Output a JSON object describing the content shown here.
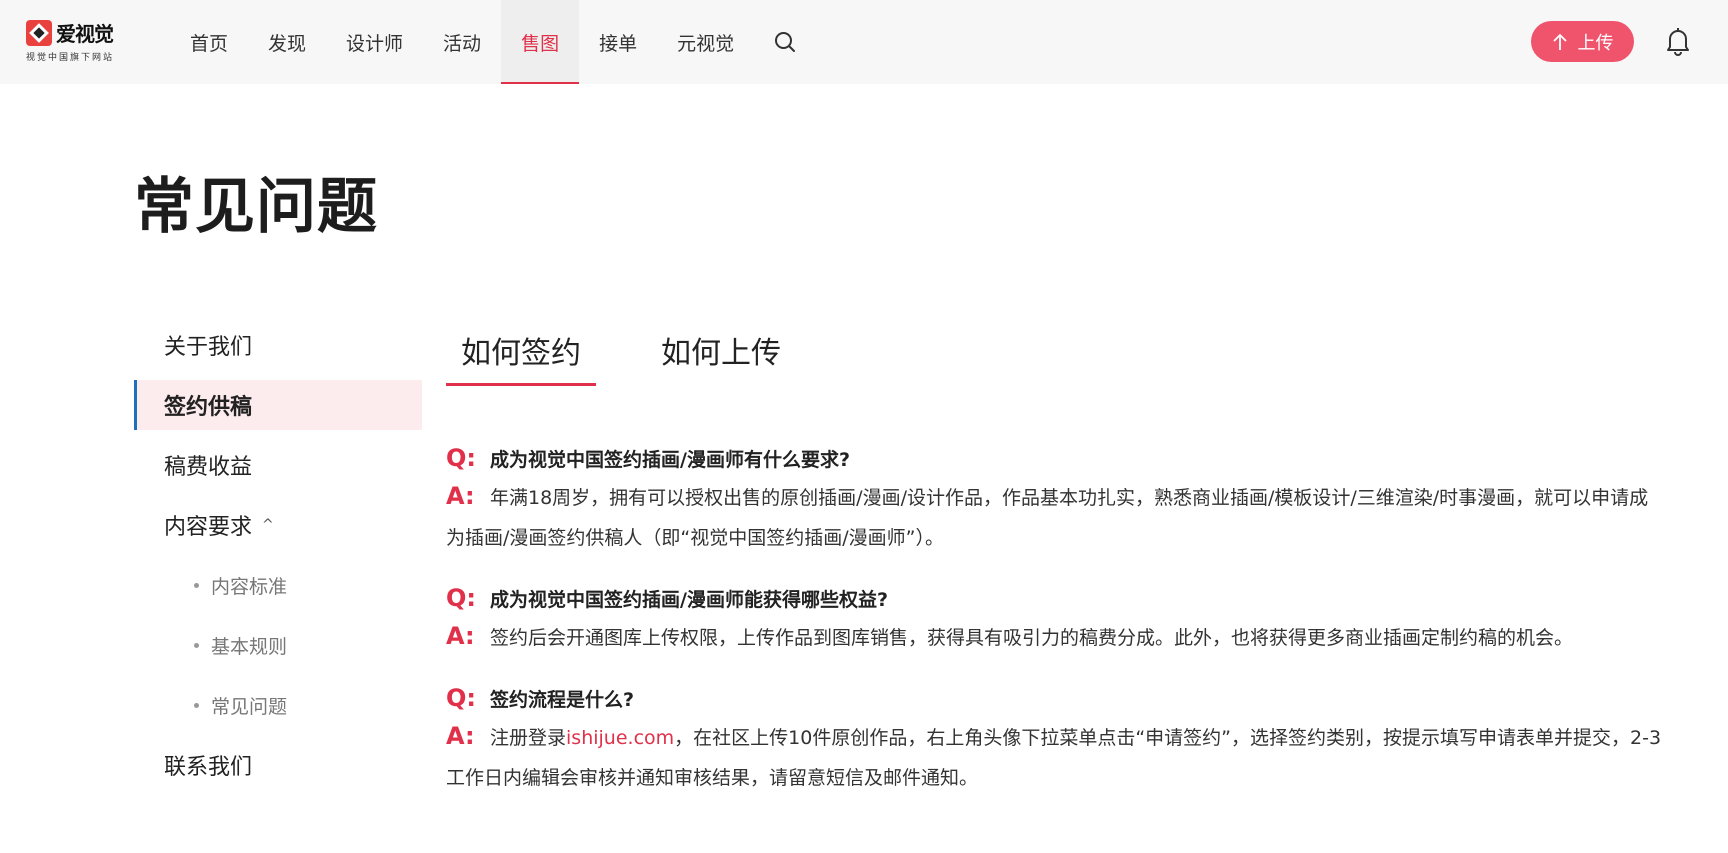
{
  "header": {
    "logo_name": "爱视觉",
    "logo_sub": "视觉中国旗下网站",
    "nav": [
      {
        "label": "首页",
        "active": false
      },
      {
        "label": "发现",
        "active": false
      },
      {
        "label": "设计师",
        "active": false
      },
      {
        "label": "活动",
        "active": false
      },
      {
        "label": "售图",
        "active": true
      },
      {
        "label": "接单",
        "active": false
      },
      {
        "label": "元视觉",
        "active": false
      }
    ],
    "upload_label": "上传",
    "accent_color": "#e0304a",
    "upload_bg": "#f0536c"
  },
  "page": {
    "title": "常见问题"
  },
  "sidebar": {
    "items": [
      {
        "label": "关于我们"
      },
      {
        "label": "签约供稿"
      },
      {
        "label": "稿费收益"
      },
      {
        "label": "内容要求"
      },
      {
        "label": "内容标准"
      },
      {
        "label": "基本规则"
      },
      {
        "label": "常见问题"
      },
      {
        "label": "联系我们"
      }
    ]
  },
  "tabs": [
    {
      "label": "如何签约"
    },
    {
      "label": "如何上传"
    }
  ],
  "faq": {
    "q_mark": "Q:",
    "a_mark": "A:",
    "items": [
      {
        "q": "成为视觉中国签约插画/漫画师有什么要求?",
        "a": "年满18周岁，拥有可以授权出售的原创插画/漫画/设计作品，作品基本功扎实，熟悉商业插画/模板设计/三维渲染/时事漫画，就可以申请成为插画/漫画签约供稿人（即“视觉中国签约插画/漫画师”）。"
      },
      {
        "q": "成为视觉中国签约插画/漫画师能获得哪些权益?",
        "a": "签约后会开通图库上传权限，上传作品到图库销售，获得具有吸引力的稿费分成。此外，也将获得更多商业插画定制约稿的机会。"
      },
      {
        "q": "签约流程是什么?",
        "a_pre": "注册登录",
        "a_link": "ishijue.com",
        "a_post": "，在社区上传10件原创作品，右上角头像下拉菜单点击“申请签约”，选择签约类别，按提示填写申请表单并提交，2-3工作日内编辑会审核并通知审核结果，请留意短信及邮件通知。"
      }
    ]
  }
}
